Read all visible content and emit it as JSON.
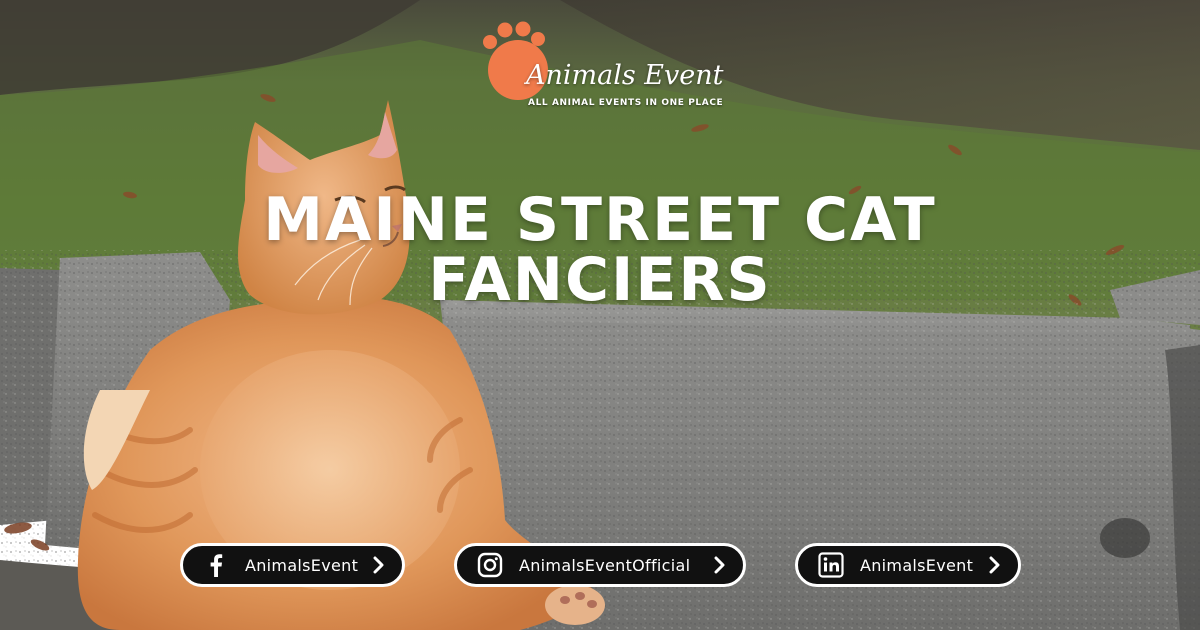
{
  "colors": {
    "accent": "#f07a4a",
    "pill_background": "#111111",
    "pill_border": "#ffffff",
    "text": "#ffffff"
  },
  "logo": {
    "name": "Animals Event",
    "tagline": "ALL ANIMAL EVENTS IN ONE PLACE"
  },
  "headline": {
    "line1": "Maine Street Cat",
    "line2": "Fanciers"
  },
  "social": [
    {
      "network": "facebook",
      "icon": "facebook-icon",
      "handle": "AnimalsEvent"
    },
    {
      "network": "instagram",
      "icon": "instagram-icon",
      "handle": "AnimalsEventOfficial"
    },
    {
      "network": "linkedin",
      "icon": "linkedin-icon",
      "handle": "AnimalsEvent"
    }
  ]
}
